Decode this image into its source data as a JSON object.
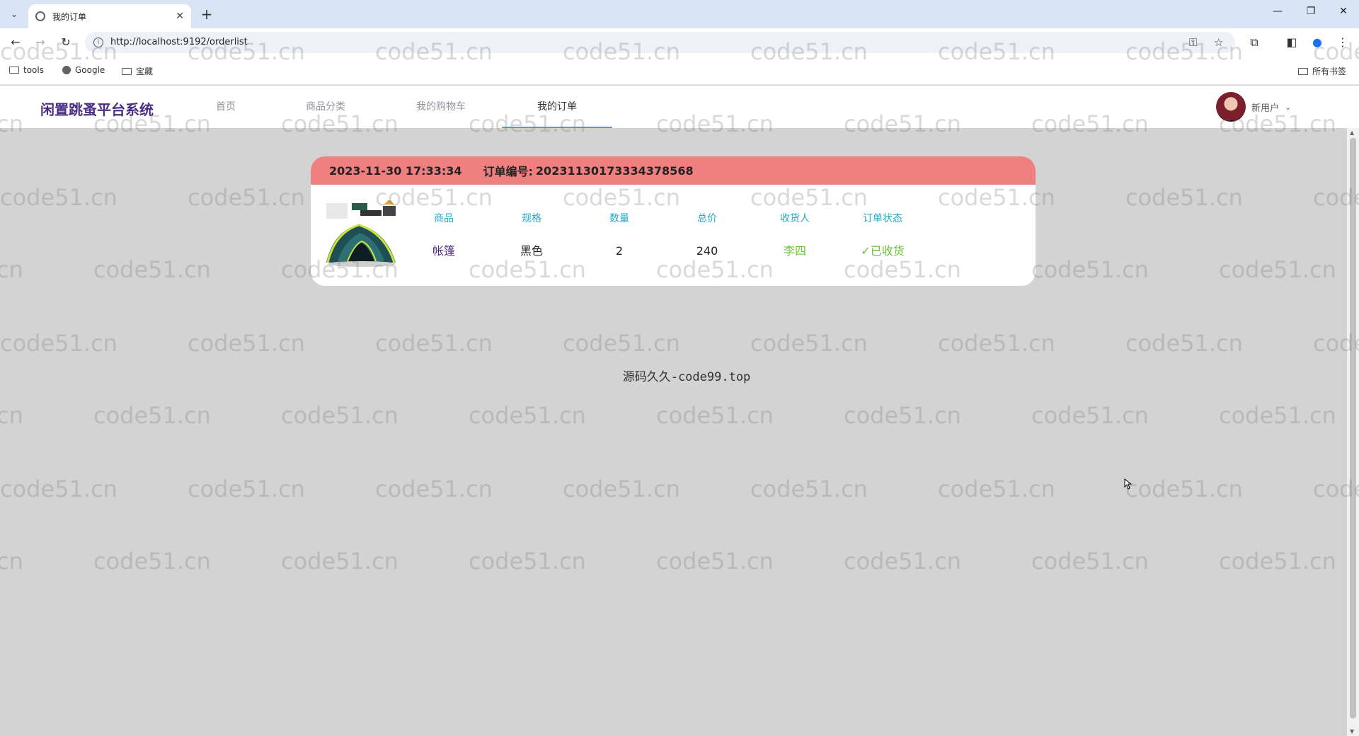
{
  "browser": {
    "tab_title": "我的订单",
    "url": "http://localhost:9192/orderlist",
    "bookmarks": [
      "tools",
      "Google",
      "宝藏"
    ],
    "all_bookmarks": "所有书签"
  },
  "site": {
    "logo": "闲置跳蚤平台系统",
    "nav": [
      "首页",
      "商品分类",
      "我的购物车",
      "我的订单"
    ],
    "active_nav": "我的订单",
    "username": "新用户"
  },
  "order": {
    "time": "2023-11-30 17:33:34",
    "no_label": "订单编号:",
    "no": "20231130173334378568",
    "columns": [
      {
        "header": "商品",
        "value": "帐篷"
      },
      {
        "header": "规格",
        "value": "黑色"
      },
      {
        "header": "数量",
        "value": "2"
      },
      {
        "header": "总价",
        "value": "240"
      },
      {
        "header": "收货人",
        "value": "李四"
      },
      {
        "header": "订单状态",
        "value": "✓已收货"
      }
    ],
    "colors": {
      "header_bg": "#f08080",
      "col_header": "#28a8c8",
      "status": "#67c23a",
      "receiver": "#67c23a",
      "product": "#4b2e83"
    }
  },
  "footer": "源码久久-code99.top",
  "watermark": "code51.cn"
}
